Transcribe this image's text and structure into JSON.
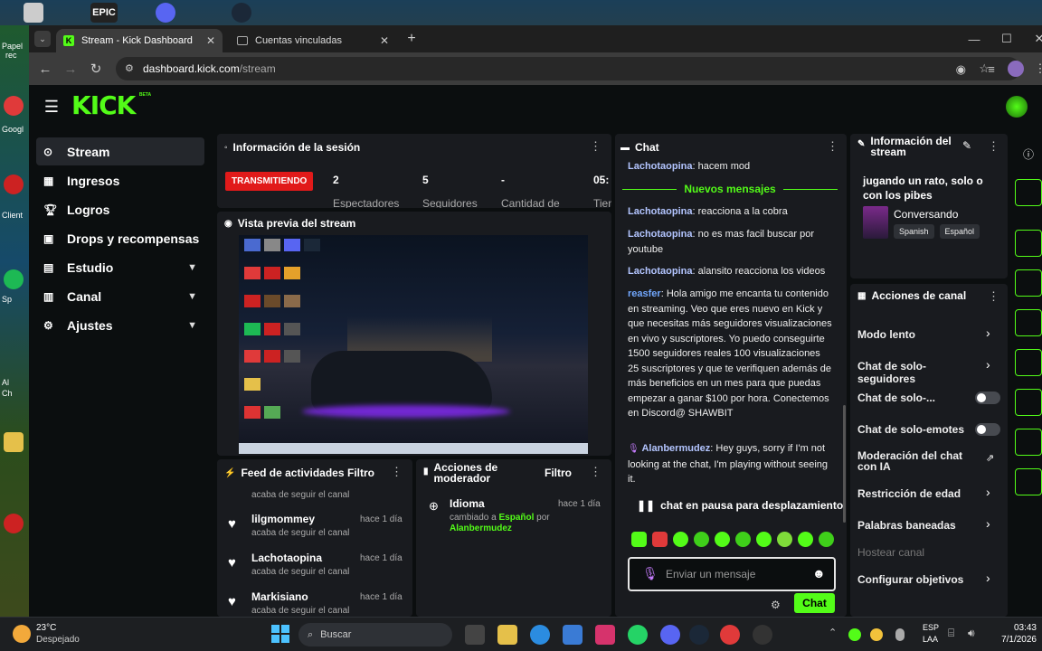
{
  "desktop": {
    "icon_labels": [
      "Papel",
      "rec",
      "Googl",
      "Client",
      "Sp",
      "Al",
      "Ch"
    ],
    "top_icon_label": "EPIC"
  },
  "browser": {
    "tabs": [
      {
        "label": "Stream - Kick Dashboard",
        "active": true
      },
      {
        "label": "Cuentas vinculadas",
        "active": false
      }
    ],
    "url_host": "dashboard.kick.com",
    "url_path": "/stream"
  },
  "kick": {
    "logo": "KICK",
    "logo_sup": "BETA",
    "nav": [
      {
        "label": "Stream",
        "icon": "video-icon",
        "selected": true,
        "chevron": false
      },
      {
        "label": "Ingresos",
        "icon": "bank-icon",
        "selected": false,
        "chevron": false
      },
      {
        "label": "Logros",
        "icon": "trophy-icon",
        "selected": false,
        "chevron": false
      },
      {
        "label": "Drops y recompensas",
        "icon": "gift-icon",
        "selected": false,
        "chevron": false
      },
      {
        "label": "Estudio",
        "icon": "studio-icon",
        "selected": false,
        "chevron": true
      },
      {
        "label": "Canal",
        "icon": "channel-icon",
        "selected": false,
        "chevron": true
      },
      {
        "label": "Ajustes",
        "icon": "gear-icon",
        "selected": false,
        "chevron": true
      }
    ],
    "session": {
      "title": "Información de la sesión",
      "live_badge": "TRANSMITIENDO",
      "stats": [
        {
          "value": "2",
          "label": "Espectadores"
        },
        {
          "value": "5",
          "label": "Seguidores"
        },
        {
          "value": "-",
          "label": "Cantidad de"
        },
        {
          "value": "05:",
          "label": "Tiem"
        }
      ]
    },
    "preview": {
      "title": "Vista previa del stream"
    },
    "feed": {
      "title": "Feed de actividades",
      "filter": "Filtro",
      "first_action": "acaba de seguir el canal",
      "items": [
        {
          "user": "lilgmommey",
          "time": "hace 1 día",
          "action": "acaba de seguir el canal"
        },
        {
          "user": "Lachotaopina",
          "time": "hace 1 día",
          "action": "acaba de seguir el canal"
        },
        {
          "user": "Markisiano",
          "time": "hace 1 día",
          "action": "acaba de seguir el canal"
        }
      ]
    },
    "mod": {
      "title_line1": "Acciones de",
      "title_line2": "moderador",
      "filter": "Filtro",
      "item_title": "Idioma",
      "item_time": "hace 1 día",
      "item_text": "cambiado a",
      "item_value": "Español",
      "item_by": "por",
      "item_user": "Alanbermudez"
    },
    "chat": {
      "title": "Chat",
      "top_user": "Lachotaopina",
      "top_text": ": hacem mod",
      "new_messages": "Nuevos mensajes",
      "messages": [
        {
          "user": "Lachotaopina",
          "text": ": reacciona a la cobra",
          "color": "#b3c5ff"
        },
        {
          "user": "Lachotaopina",
          "text": ": no es mas facil buscar por youtube",
          "color": "#b3c5ff"
        },
        {
          "user": "Lachotaopina",
          "text": ": alansito reacciona los videos",
          "color": "#b3c5ff"
        },
        {
          "user": "reasfer",
          "text": ": Hola amigo me encanta tu contenido en streaming. Veo que eres nuevo en Kick y que necesitas más seguidores visualizaciones en vivo y suscriptores. Yo puedo conseguirte 1500 seguidores reales 100 visualizaciones 25 suscriptores y que te verifiquen además de más beneficios en un mes para que puedas empezar a ganar $100 por hora. Conectemos en Discord@ SHAWBIT",
          "color": "#72a8ff"
        },
        {
          "user": "Alanbermudez",
          "text": ": Hey guys, sorry if I'm not looking at the chat, I'm playing without seeing it.",
          "color": "#b3c5ff"
        }
      ],
      "paused": "chat en pausa para desplazamiento",
      "input_placeholder": "Enviar un mensaje",
      "send_button": "Chat"
    },
    "stream_info": {
      "title_line1": "Información del",
      "title_line2": "stream",
      "stream_title": "jugando un rato, solo o con los pibes",
      "category": "Conversando",
      "tags": [
        "Spanish",
        "Español"
      ]
    },
    "channel_actions": {
      "title": "Acciones de canal",
      "items": [
        {
          "label": "Modo lento",
          "control": "chevron"
        },
        {
          "label": "Chat de solo-seguidores",
          "control": "chevron"
        },
        {
          "label": "Chat de solo-...",
          "control": "toggle"
        },
        {
          "label": "Chat de solo-emotes",
          "control": "toggle"
        },
        {
          "label": "Moderación del chat con IA",
          "control": "external"
        },
        {
          "label": "Restricción de edad",
          "control": "chevron"
        },
        {
          "label": "Palabras baneadas",
          "control": "chevron"
        },
        {
          "label": "Hostear canal",
          "control": "disabled"
        },
        {
          "label": "Configurar objetivos",
          "control": "chevron"
        }
      ]
    }
  },
  "taskbar": {
    "weather_temp": "23°C",
    "weather_desc": "Despejado",
    "search_placeholder": "Buscar",
    "lang_line1": "ESP",
    "lang_line2": "LAA",
    "time": "03:43",
    "date": "7/1/2026"
  }
}
